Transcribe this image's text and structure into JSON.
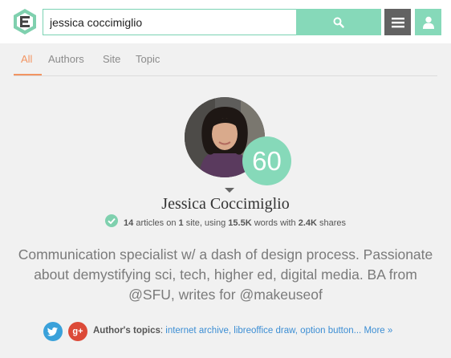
{
  "search": {
    "value": "jessica coccimiglio"
  },
  "tabs": [
    {
      "label": "All",
      "active": true
    },
    {
      "label": "Authors",
      "active": false
    },
    {
      "label": "Site",
      "active": false
    },
    {
      "label": "Topic",
      "active": false
    }
  ],
  "author": {
    "name": "Jessica Coccimiglio",
    "score": "60",
    "stats": {
      "articles": "14",
      "articles_text": " articles on ",
      "sites": "1",
      "sites_text": " site, using ",
      "words": "15.5K",
      "words_text": " words with ",
      "shares": "2.4K",
      "shares_text": " shares"
    },
    "bio": "Communication specialist w/ a dash of design process. Passionate about demystifying sci, tech, higher ed, digital media. BA from @SFU, writes for @makeuseof"
  },
  "topics": {
    "label": "Author's topics",
    "separator": ": ",
    "items": "internet archive, libreoffice draw, option button...",
    "more": "More »"
  },
  "social": {
    "gplus_glyph": "g+"
  },
  "colors": {
    "accent_green": "#86d9b9",
    "tab_active": "#f29562",
    "menu_gray": "#626262",
    "link_blue": "#3c8ed4",
    "twitter": "#3aa1da",
    "gplus": "#dc4a38"
  },
  "icons": {
    "logo": "e-logo-icon",
    "search": "search-icon",
    "menu": "hamburger-menu-icon",
    "user": "user-icon",
    "verified": "check-icon",
    "twitter": "twitter-icon",
    "gplus": "google-plus-icon"
  }
}
